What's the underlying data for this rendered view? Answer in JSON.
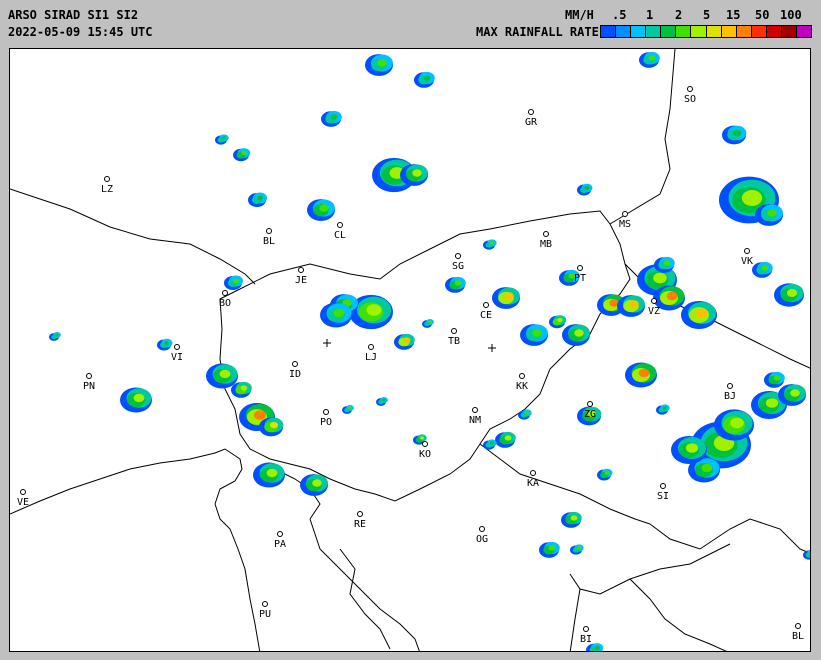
{
  "header": {
    "title": "ARSO SIRAD SI1 SI2",
    "timestamp": "2022-05-09 15:45 UTC",
    "unit": "MM/H",
    "legend_title": "MAX RAINFALL RATE"
  },
  "legend": {
    "ticks": [
      ".5",
      "1",
      "2",
      "5",
      "15",
      "50",
      "100"
    ],
    "colors": [
      "#0050ff",
      "#0090ff",
      "#00c0ff",
      "#00c8a0",
      "#00c040",
      "#40e000",
      "#a0f000",
      "#e0e000",
      "#ffc000",
      "#ff8000",
      "#ff3000",
      "#d00000",
      "#a00000",
      "#c000c0"
    ]
  },
  "map": {
    "cities": [
      {
        "code": "GR"
      },
      {
        "code": "SO"
      },
      {
        "code": "LZ"
      },
      {
        "code": "BL"
      },
      {
        "code": "CL"
      },
      {
        "code": "MS"
      },
      {
        "code": "MB"
      },
      {
        "code": "VK"
      },
      {
        "code": "SG"
      },
      {
        "code": "JE"
      },
      {
        "code": "PT"
      },
      {
        "code": "BO"
      },
      {
        "code": "CE"
      },
      {
        "code": "VZ"
      },
      {
        "code": "TB"
      },
      {
        "code": "LJ"
      },
      {
        "code": "VI"
      },
      {
        "code": "PN"
      },
      {
        "code": "ID"
      },
      {
        "code": "KK"
      },
      {
        "code": "BJ"
      },
      {
        "code": "PO"
      },
      {
        "code": "NM"
      },
      {
        "code": "ZG"
      },
      {
        "code": "KO"
      },
      {
        "code": "KA"
      },
      {
        "code": "SI"
      },
      {
        "code": "VE"
      },
      {
        "code": "RE"
      },
      {
        "code": "PA"
      },
      {
        "code": "OG"
      },
      {
        "code": "PU"
      },
      {
        "code": "BI"
      },
      {
        "code": "BL"
      }
    ]
  }
}
